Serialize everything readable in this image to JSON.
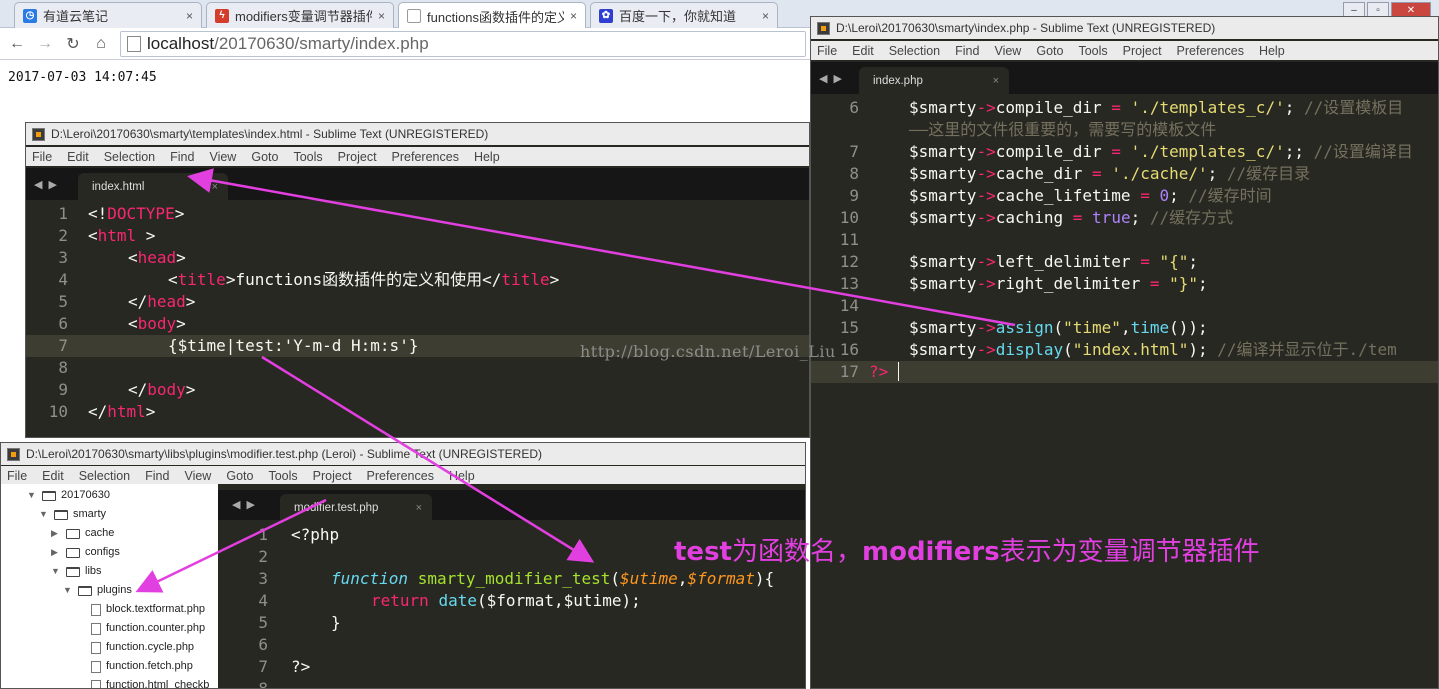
{
  "browser": {
    "tabs": [
      {
        "title": "有道云笔记",
        "close": "×",
        "favicon": "youdao-icon"
      },
      {
        "title": "modifiers变量调节器插件",
        "close": "×",
        "favicon": "csdn-icon"
      },
      {
        "title": "functions函数插件的定义",
        "close": "×",
        "favicon": "page-icon"
      },
      {
        "title": "百度一下，你就知道",
        "close": "×",
        "favicon": "baidu-icon"
      }
    ],
    "address": {
      "host": "localhost",
      "path": "/20170630/smarty/index.php"
    },
    "page_text": "2017-07-03 14:07:45"
  },
  "menu": [
    "File",
    "Edit",
    "Selection",
    "Find",
    "View",
    "Goto",
    "Tools",
    "Project",
    "Preferences",
    "Help"
  ],
  "win_index_php": {
    "title": "D:\\Leroi\\20170630\\smarty\\index.php - Sublime Text (UNREGISTERED)",
    "tab": "index.php",
    "tab_close": "×",
    "line_numbers": [
      "6",
      "",
      "7",
      "8",
      "9",
      "10",
      "11",
      "12",
      "13",
      "14",
      "15",
      "16",
      "17"
    ]
  },
  "win_index_html": {
    "title": "D:\\Leroi\\20170630\\smarty\\templates\\index.html - Sublime Text (UNREGISTERED)",
    "tab": "index.html",
    "tab_close": "×",
    "line_numbers": [
      "1",
      "2",
      "3",
      "4",
      "5",
      "6",
      "7",
      "8",
      "9",
      "10"
    ]
  },
  "win_modifier": {
    "title": "D:\\Leroi\\20170630\\smarty\\libs\\plugins\\modifier.test.php (Leroi) - Sublime Text (UNREGISTERED)",
    "tab": "modifier.test.php",
    "tab_close": "×",
    "line_numbers": [
      "1",
      "2",
      "3",
      "4",
      "5",
      "6",
      "7",
      "8"
    ],
    "sidebar": [
      "20170630",
      "smarty",
      "cache",
      "configs",
      "libs",
      "plugins",
      "block.textformat.php",
      "function.counter.php",
      "function.cycle.php",
      "function.fetch.php",
      "function.html_checkb"
    ]
  },
  "watermark": "http://blog.csdn.net/Leroi_Liu",
  "annotation": {
    "part1": "test",
    "part2": "为函数名，",
    "part3": "modifiers",
    "part4": "表示为变量调节器插件"
  },
  "colors": {
    "annotation": "#e23fe0",
    "editor_bg": "#272822",
    "keyword": "#f92672",
    "string": "#e6db74",
    "comment": "#75715e"
  }
}
